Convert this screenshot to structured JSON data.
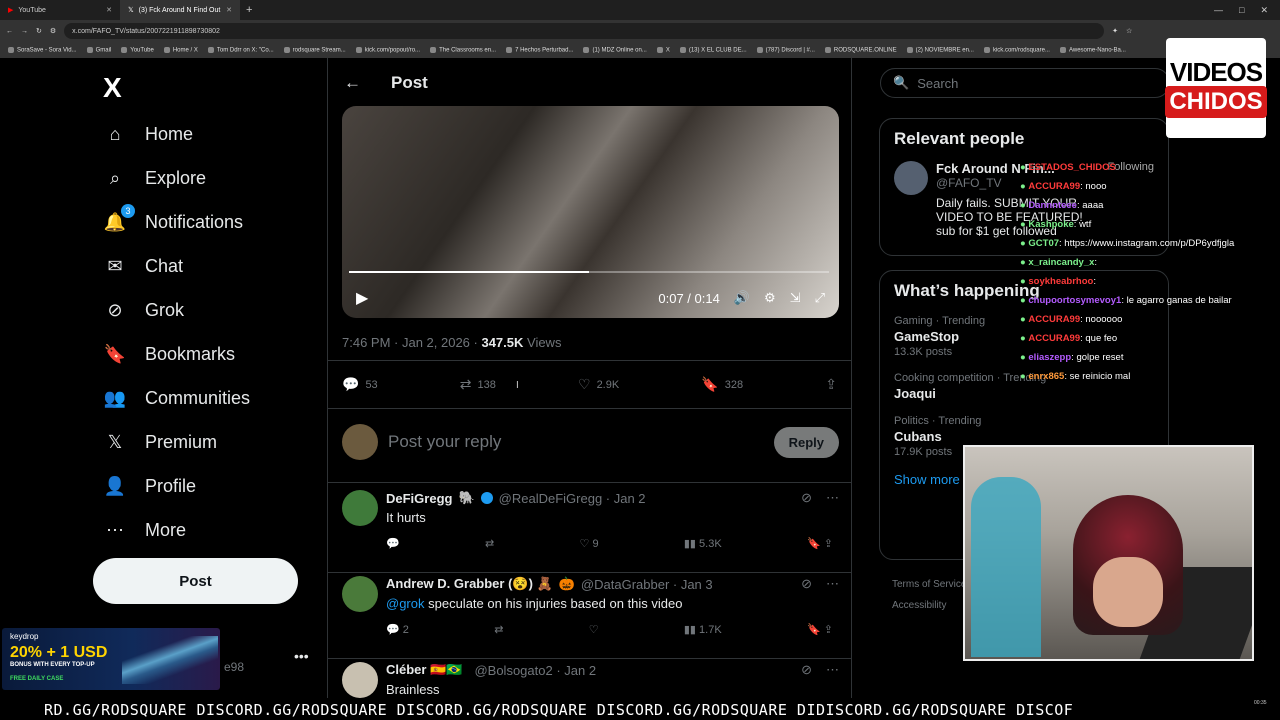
{
  "browser": {
    "tabs": [
      {
        "title": "YouTube",
        "active": false
      },
      {
        "title": "(3) Fck Around N Find Out",
        "active": true
      }
    ],
    "new_tab": "+",
    "url": "x.com/FAFO_TV/status/2007221911898730802",
    "bookmarks": [
      "SoraSave - Sora Vid...",
      "Gmail",
      "YouTube",
      "Home / X",
      "Tom Ddrr on X: \"Co...",
      "rodsquare Stream...",
      "kick.com/popout/ro...",
      "The Classrooms en...",
      "7 Hechos Perturbad...",
      "(1) MDZ Online on...",
      "X",
      "(13) X EL CLUB DE...",
      "(787) Discord | #...",
      "RODSQUARE.ONLINE",
      "(2) NOVIEMBRE en...",
      "kick.com/rodsquare...",
      "Awesome-Nano-Ba..."
    ]
  },
  "sidebar": {
    "logo": "X",
    "items": [
      {
        "label": "Home",
        "icon": "home-icon"
      },
      {
        "label": "Explore",
        "icon": "search-icon"
      },
      {
        "label": "Notifications",
        "icon": "bell-icon",
        "badge": "3"
      },
      {
        "label": "Chat",
        "icon": "mail-icon"
      },
      {
        "label": "Grok",
        "icon": "grok-icon"
      },
      {
        "label": "Bookmarks",
        "icon": "bookmark-icon"
      },
      {
        "label": "Communities",
        "icon": "people-icon"
      },
      {
        "label": "Premium",
        "icon": "x-icon"
      },
      {
        "label": "Profile",
        "icon": "person-icon"
      },
      {
        "label": "More",
        "icon": "more-circle-icon"
      }
    ],
    "post_button": "Post",
    "account_fragment": "e98"
  },
  "main": {
    "header_title": "Post",
    "video": {
      "time": "0:07 / 0:14",
      "progress": 0.5
    },
    "meta": {
      "time": "7:46 PM · Jan 2, 2026 · ",
      "views": "347.5K",
      "views_label": " Views"
    },
    "actions": {
      "replies": "53",
      "reposts": "138",
      "likes": "2.9K",
      "bookmarks": "328"
    },
    "reply_placeholder": "Post your reply",
    "reply_button": "Reply",
    "tweets": [
      {
        "name": "DeFiGregg",
        "emoji": "🐘",
        "handle": "@RealDeFiGregg · Jan 2",
        "mention": "",
        "text": "It hurts",
        "replies": "",
        "reposts": "",
        "likes": "9",
        "views": "5.3K"
      },
      {
        "name": "Andrew D. Grabber (😵) 🧸",
        "emoji": "🎃",
        "handle": "@DataGrabber · Jan 3",
        "mention": "@grok",
        "text": " speculate on his injuries based on this video",
        "replies": "2",
        "reposts": "",
        "likes": "",
        "views": "1.7K"
      },
      {
        "name": "Cléber 🇪🇸🇧🇷",
        "emoji": "",
        "handle": "@Bolsogato2 · Jan 2",
        "mention": "",
        "text": "Brainless",
        "replies": "",
        "reposts": "",
        "likes": "",
        "views": ""
      }
    ]
  },
  "right": {
    "search_placeholder": "Search",
    "relevant_title": "Relevant people",
    "relevant": {
      "name": "Fck Around N Fin...",
      "handle": "@FAFO_TV",
      "bio": "Daily fails. SUBMIT YOUR VIDEO TO BE FEATURED! sub for $1 get followed",
      "button": "Following"
    },
    "happening_title": "What’s happening",
    "trends": [
      {
        "category": "Gaming · Trending",
        "name": "GameStop",
        "count": "13.3K posts"
      },
      {
        "category": "Cooking competition · Trending",
        "name": "Joaqui",
        "count": ""
      },
      {
        "category": "Politics · Trending",
        "name": "Cubans",
        "count": "17.9K posts"
      }
    ],
    "show_more": "Show more",
    "footer": [
      "Terms of Service",
      "Accessibility"
    ]
  },
  "overlay": {
    "logo_top": "VIDEOS",
    "logo_bottom": "CHIDOS",
    "chat": [
      {
        "user": "ESTADOS_CHIDOS",
        "msg": "",
        "color": "#ff3b3b"
      },
      {
        "user": "ACCURA99",
        "msg": ": nooo",
        "color": "#ff3b3b"
      },
      {
        "user": "Dannnteee",
        "msg": ": aaaa",
        "color": "#b45cff"
      },
      {
        "user": "Kashpoke",
        "msg": ": wtf",
        "color": "#7cf08c"
      },
      {
        "user": "GCT07",
        "msg": ": https://www.instagram.com/p/DP6ydfjgla",
        "color": "#7cf08c"
      },
      {
        "user": "x_raincandy_x",
        "msg": ":",
        "color": "#7cf08c"
      },
      {
        "user": "soykheabrhoo",
        "msg": ":",
        "color": "#ff3b3b"
      },
      {
        "user": "chupoortosymevoy1",
        "msg": ": le agarro ganas de bailar",
        "color": "#b45cff"
      },
      {
        "user": "ACCURA99",
        "msg": ": noooooo",
        "color": "#ff3b3b"
      },
      {
        "user": "ACCURA99",
        "msg": ": que feo",
        "color": "#ff3b3b"
      },
      {
        "user": "eliaszepp",
        "msg": ": golpe reset",
        "color": "#b45cff"
      },
      {
        "user": "enrx865",
        "msg": ": se reinicio mal",
        "color": "#ff9a3b"
      }
    ],
    "promo": {
      "brand": "keydrop",
      "headline": "20% + 1 USD",
      "sub": "BONUS WITH EVERY TOP-UP",
      "case": "FREE DAILY CASE"
    },
    "ticker": "RD.GG/RODSQUARE DISCORD.GG/RODSQUARE DISCORD.GG/RODSQUARE DISCORD.GG/RODSQUARE DIDISCORD.GG/RODSQUARE DISCOF",
    "clock": "00:35"
  },
  "colors": {
    "accent": "#1d9bf0",
    "bg": "#000000",
    "border": "#2f3336",
    "muted": "#71767b"
  }
}
